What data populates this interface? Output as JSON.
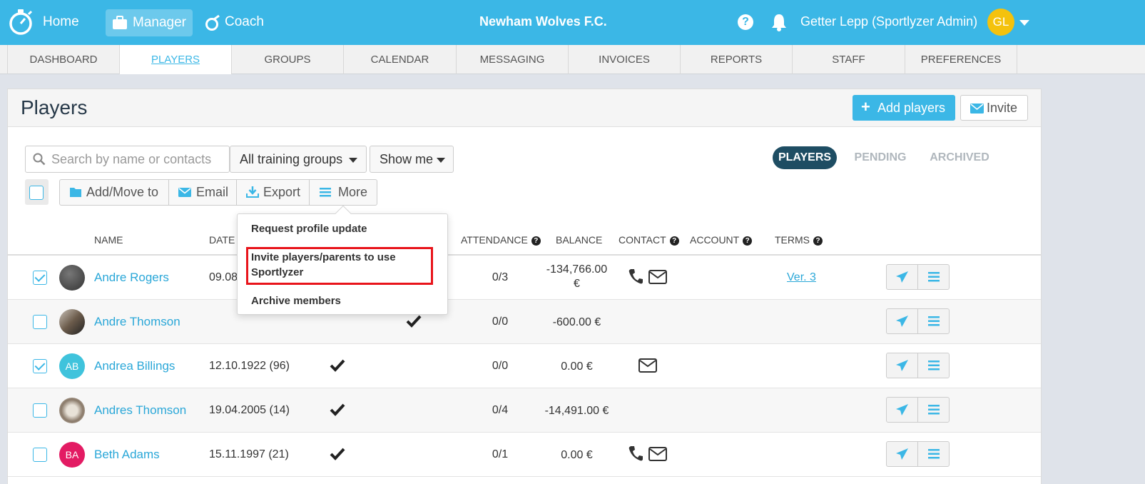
{
  "topbar": {
    "home": "Home",
    "manager": "Manager",
    "coach": "Coach",
    "club_name": "Newham Wolves F.C.",
    "help": "?",
    "user_name": "Getter Lepp (Sportlyzer Admin)",
    "user_initials": "GL"
  },
  "subnav": {
    "tabs": [
      "DASHBOARD",
      "PLAYERS",
      "GROUPS",
      "CALENDAR",
      "MESSAGING",
      "INVOICES",
      "REPORTS",
      "STAFF",
      "PREFERENCES"
    ],
    "active": "PLAYERS"
  },
  "page": {
    "title": "Players",
    "add_players": "Add players",
    "invite": "Invite"
  },
  "filters": {
    "search_placeholder": "Search by name or contacts",
    "groups": "All training groups",
    "show_me": "Show me",
    "pills": [
      "PLAYERS",
      "PENDING",
      "ARCHIVED"
    ]
  },
  "toolbar": {
    "add_move": "Add/Move to",
    "email": "Email",
    "export": "Export",
    "more": "More"
  },
  "more_menu": {
    "items": [
      "Request profile update",
      "Invite players/parents to use Sportlyzer",
      "Archive members"
    ],
    "highlighted": "Invite players/parents to use Sportlyzer"
  },
  "table": {
    "headers": {
      "name": "NAME",
      "date": "DATE",
      "attendance": "ATTENDANCE",
      "balance": "BALANCE",
      "contact": "CONTACT",
      "account": "ACCOUNT",
      "terms": "TERMS"
    },
    "rows": [
      {
        "name": "Andre Rogers",
        "dob": "09.08",
        "attendance": "0/3",
        "balance_line1": "-134,766.00",
        "balance_line2": "€",
        "terms": "Ver. 3",
        "checked": true
      },
      {
        "name": "Andre Thomson",
        "dob": "",
        "attendance": "0/0",
        "balance": "-600.00 €",
        "checked": false
      },
      {
        "name": "Andrea Billings",
        "initials": "AB",
        "dob": "12.10.1922 (96)",
        "attendance": "0/0",
        "balance": "0.00 €",
        "checked": true
      },
      {
        "name": "Andres Thomson",
        "dob": "19.04.2005 (14)",
        "attendance": "0/4",
        "balance": "-14,491.00 €",
        "checked": false
      },
      {
        "name": "Beth Adams",
        "initials": "BA",
        "dob": "15.11.1997 (21)",
        "attendance": "0/1",
        "balance": "0.00 €",
        "checked": false
      }
    ]
  },
  "colors": {
    "brand": "#3bb7e6",
    "active_pill": "#1e4d63",
    "highlight_box": "#e8141b",
    "avatar_gl": "#f4c20d",
    "avatar_ab": "#3fc3dc",
    "avatar_ba": "#e31b63"
  }
}
